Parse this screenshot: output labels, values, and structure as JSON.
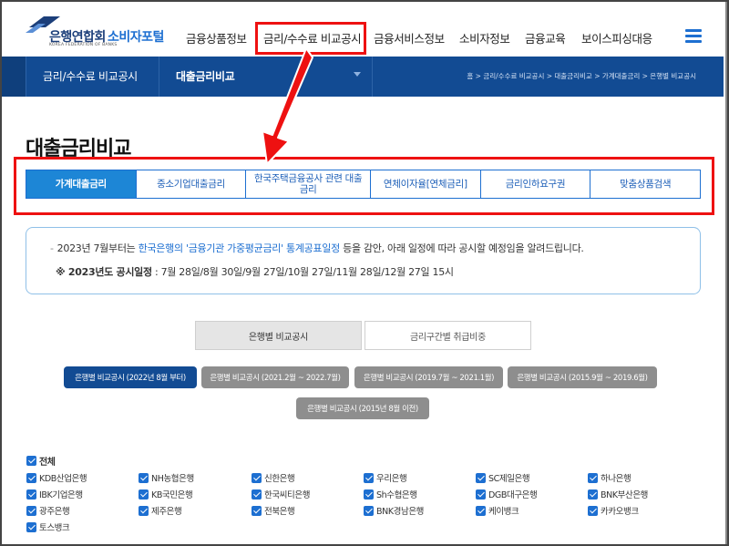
{
  "header": {
    "logo_main": "은행연합회",
    "logo_sub": "KOREA FEDERATION OF BANKS",
    "logo_portal": "소비자포털",
    "nav": [
      "금융상품정보",
      "금리/수수료 비교공시",
      "금융서비스정보",
      "소비자정보",
      "금융교육",
      "보이스피싱대응"
    ],
    "menu_icon": "hamburger-menu-icon"
  },
  "bluebar": {
    "menu1": "금리/수수료 비교공시",
    "menu2": "대출금리비교",
    "breadcrumb": "홈 > 금리/수수료 비교공시 > 대출금리비교 > 가계대출금리 > 은행별 비교공시"
  },
  "page_title": "대출금리비교",
  "tabs": [
    "가계대출금리",
    "중소기업대출금리",
    "한국주택금융공사 관련 대출금리",
    "연체이자율[연체금리]",
    "금리인하요구권",
    "맞춤상품검색"
  ],
  "notice": {
    "l1_a": "2023년 7월부터는 ",
    "l1_b": "한국은행의 '금융기관 가중평균금리' 통계공표일정",
    "l1_c": " 등을 감안, 아래 일정에 따라 공시할 예정임을 알려드립니다.",
    "l2_label": "※ 2023년도 공시일정",
    "l2_value": " : 7월 28일/8월 30일/9월 27일/10월 27일/11월 28일/12월 27일 15시"
  },
  "views": [
    "은행별 비교공시",
    "금리구간별 취급비중"
  ],
  "periods": [
    "은행별 비교공시 (2022년 8월 부터)",
    "은행별 비교공시 (2021.2월 ~ 2022.7월)",
    "은행별 비교공시 (2019.7월 ~ 2021.1월)",
    "은행별 비교공시 (2015.9월 ~ 2019.6월)",
    "은행별 비교공시 (2015년 8월 이전)"
  ],
  "check_all": "전체",
  "banks": [
    "KDB산업은행",
    "NH농협은행",
    "신한은행",
    "우리은행",
    "SC제일은행",
    "하나은행",
    "IBK기업은행",
    "KB국민은행",
    "한국씨티은행",
    "Sh수협은행",
    "DGB대구은행",
    "BNK부산은행",
    "광주은행",
    "제주은행",
    "전북은행",
    "BNK경남은행",
    "케이뱅크",
    "카카오뱅크",
    "토스뱅크"
  ],
  "colors": {
    "brand_blue": "#124b93",
    "accent_blue": "#1d6fd1",
    "highlight_red": "#e11111"
  }
}
